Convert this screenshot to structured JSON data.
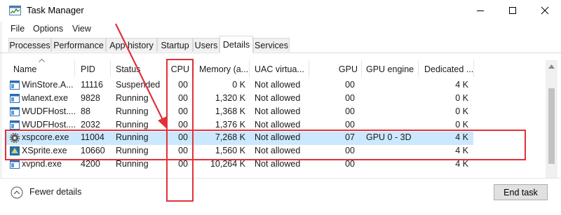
{
  "window": {
    "title": "Task Manager",
    "app_icon": "task-manager-icon",
    "controls": [
      "minimize-icon",
      "maximize-icon",
      "close-icon"
    ]
  },
  "menu": {
    "file": "File",
    "options": "Options",
    "view": "View"
  },
  "tabs": [
    {
      "label": "Processes",
      "active": false
    },
    {
      "label": "Performance",
      "active": false
    },
    {
      "label": "App history",
      "active": false
    },
    {
      "label": "Startup",
      "active": false
    },
    {
      "label": "Users",
      "active": false
    },
    {
      "label": "Details",
      "active": true
    },
    {
      "label": "Services",
      "active": false
    }
  ],
  "table": {
    "columns": {
      "name": "Name",
      "pid": "PID",
      "status": "Status",
      "cpu": "CPU",
      "memory": "Memory (a...",
      "uac": "UAC virtua...",
      "gpu": "GPU",
      "gpu_engine": "GPU engine",
      "dedicated": "Dedicated ..."
    },
    "rows": [
      {
        "name": "WinStore.A...",
        "pid": "11116",
        "status": "Suspended",
        "cpu": "00",
        "memory": "0 K",
        "uac": "Not allowed",
        "gpu": "00",
        "gpu_engine": "",
        "dedicated": "4 K",
        "icon": "app-window-icon",
        "selected": false
      },
      {
        "name": "wlanext.exe",
        "pid": "9828",
        "status": "Running",
        "cpu": "00",
        "memory": "1,320 K",
        "uac": "Not allowed",
        "gpu": "00",
        "gpu_engine": "",
        "dedicated": "0 K",
        "icon": "app-window-icon",
        "selected": false
      },
      {
        "name": "WUDFHost....",
        "pid": "88",
        "status": "Running",
        "cpu": "00",
        "memory": "1,368 K",
        "uac": "Not allowed",
        "gpu": "00",
        "gpu_engine": "",
        "dedicated": "0 K",
        "icon": "app-window-icon",
        "selected": false
      },
      {
        "name": "WUDFHost....",
        "pid": "2032",
        "status": "Running",
        "cpu": "00",
        "memory": "1,376 K",
        "uac": "Not allowed",
        "gpu": "00",
        "gpu_engine": "",
        "dedicated": "0 K",
        "icon": "app-window-icon",
        "selected": false
      },
      {
        "name": "xspcore.exe",
        "pid": "11004",
        "status": "Running",
        "cpu": "00",
        "memory": "7,268 K",
        "uac": "Not allowed",
        "gpu": "07",
        "gpu_engine": "GPU 0 - 3D",
        "dedicated": "4 K",
        "icon": "gear-icon",
        "selected": true
      },
      {
        "name": "XSprite.exe",
        "pid": "10660",
        "status": "Running",
        "cpu": "00",
        "memory": "1,560 K",
        "uac": "Not allowed",
        "gpu": "00",
        "gpu_engine": "",
        "dedicated": "4 K",
        "icon": "xsprite-icon",
        "selected": false
      },
      {
        "name": "xvpnd.exe",
        "pid": "4200",
        "status": "Running",
        "cpu": "00",
        "memory": "10,264 K",
        "uac": "Not allowed",
        "gpu": "00",
        "gpu_engine": "",
        "dedicated": "4 K",
        "icon": "app-window-icon",
        "selected": false
      }
    ]
  },
  "footer": {
    "fewer_details": "Fewer details",
    "end_task": "End task"
  },
  "colors": {
    "annotation_red": "#e0323a",
    "selection": "#cce8ff"
  }
}
